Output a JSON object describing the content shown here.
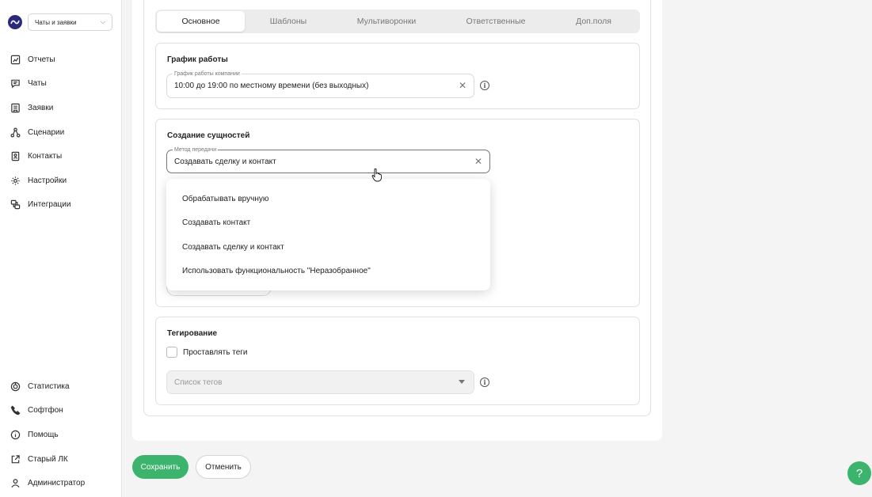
{
  "sidebar": {
    "workspace": "Чаты и заявки",
    "top_items": [
      {
        "label": "Отчеты",
        "icon": "chart-icon"
      },
      {
        "label": "Чаты",
        "icon": "chat-icon"
      },
      {
        "label": "Заявки",
        "icon": "requests-icon"
      },
      {
        "label": "Сценарии",
        "icon": "scenarios-icon"
      },
      {
        "label": "Контакты",
        "icon": "contacts-icon"
      },
      {
        "label": "Настройки",
        "icon": "gear-icon"
      },
      {
        "label": "Интеграции",
        "icon": "integrations-icon"
      }
    ],
    "bottom_items": [
      {
        "label": "Статистика",
        "icon": "stats-icon"
      },
      {
        "label": "Софтфон",
        "icon": "phone-icon"
      },
      {
        "label": "Помощь",
        "icon": "help-icon"
      },
      {
        "label": "Старый ЛК",
        "icon": "external-link-icon"
      },
      {
        "label": "Администратор",
        "icon": "user-icon"
      }
    ]
  },
  "tabs": [
    "Основное",
    "Шаблоны",
    "Мультиворонки",
    "Ответственные",
    "Доп.поля"
  ],
  "active_tab": 0,
  "schedule": {
    "title": "График работы",
    "field_label": "График работы компании",
    "field_value": "10:00 до 19:00 по местному времени (без выходных)"
  },
  "entities": {
    "title": "Создание сущностей",
    "field_label": "Метод передачи",
    "field_value": "Создавать сделку и контакт",
    "options": [
      "Обрабатывать вручную",
      "Создавать контакт",
      "Создавать сделку и контакт",
      "Использовать функциональность \"Неразобранное\""
    ]
  },
  "tagging": {
    "title": "Тегирование",
    "checkbox_label": "Проставлять теги",
    "checked": false,
    "tags_placeholder": "Список тегов"
  },
  "buttons": {
    "save": "Сохранить",
    "cancel": "Отменить",
    "help": "?"
  },
  "colors": {
    "accent": "#3db46d",
    "logo": "#2b2a7a"
  }
}
